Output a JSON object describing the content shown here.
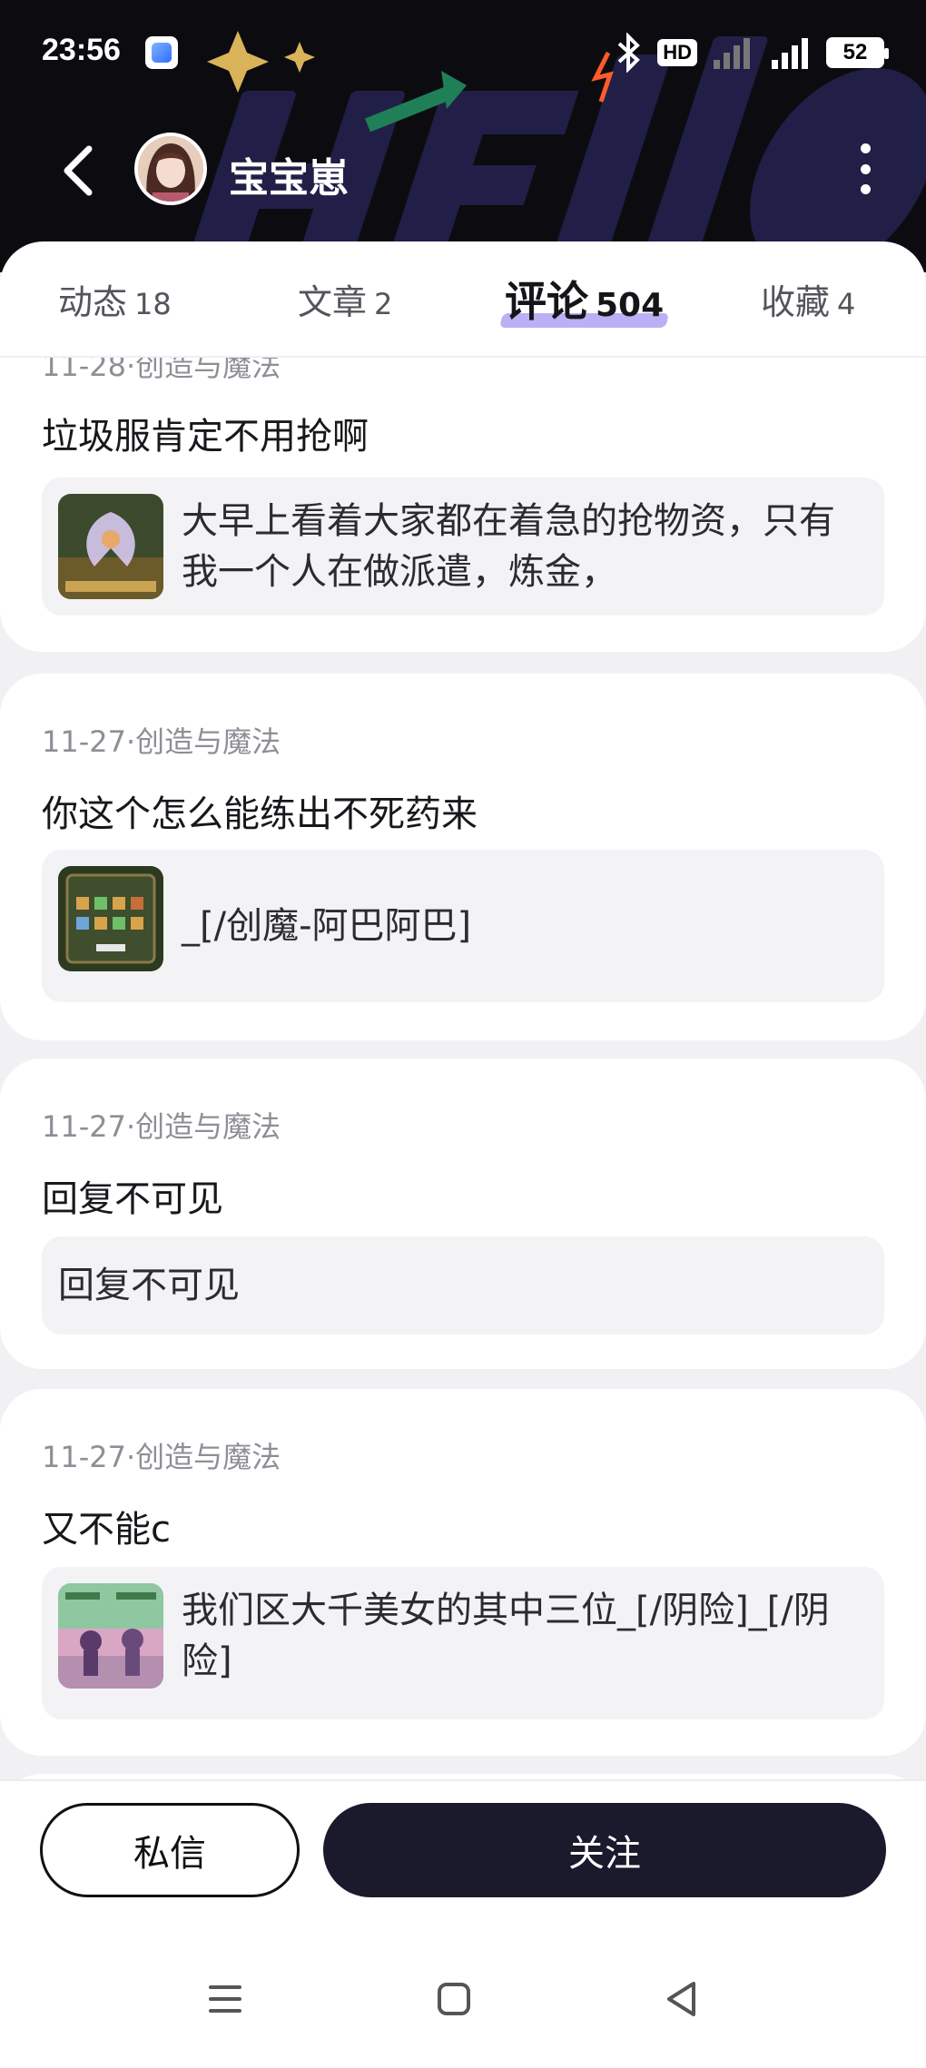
{
  "status_bar": {
    "time": "23:56",
    "hd_label": "HD",
    "battery": "52"
  },
  "header": {
    "username": "宝宝崽",
    "icons": [
      "back-arrow-icon",
      "avatar",
      "more-vertical-icon"
    ]
  },
  "tabs": [
    {
      "label": "动态",
      "count": "18"
    },
    {
      "label": "文章",
      "count": "2"
    },
    {
      "label": "评论",
      "count": "504",
      "active": true
    },
    {
      "label": "收藏",
      "count": "4"
    }
  ],
  "comments": [
    {
      "meta": "11-28·创造与魔法",
      "text": "垃圾服肯定不用抢啊",
      "quote": "大早上看着大家都在着急的抢物资，只有我一个人在做派遣，炼金，",
      "has_thumb": true
    },
    {
      "meta": "11-27·创造与魔法",
      "text": "你这个怎么能练出不死药来",
      "quote": "_[/创魔-阿巴阿巴]",
      "has_thumb": true
    },
    {
      "meta": "11-27·创造与魔法",
      "text": "回复不可见",
      "quote": "回复不可见",
      "has_thumb": false
    },
    {
      "meta": "11-27·创造与魔法",
      "text": "又不能c",
      "quote": "我们区大千美女的其中三位_[/阴险]_[/阴险]",
      "has_thumb": true
    }
  ],
  "actions": {
    "message_label": "私信",
    "follow_label": "关注"
  },
  "nav_bar": {
    "icons": [
      "menu-icon",
      "home-square-icon",
      "back-triangle-icon"
    ]
  },
  "colors": {
    "header_bg": "#0c0c10",
    "accent_underline": "#b9b0f5",
    "follow_button": "#1b1a2c",
    "page_bg": "#f1f1f3"
  }
}
